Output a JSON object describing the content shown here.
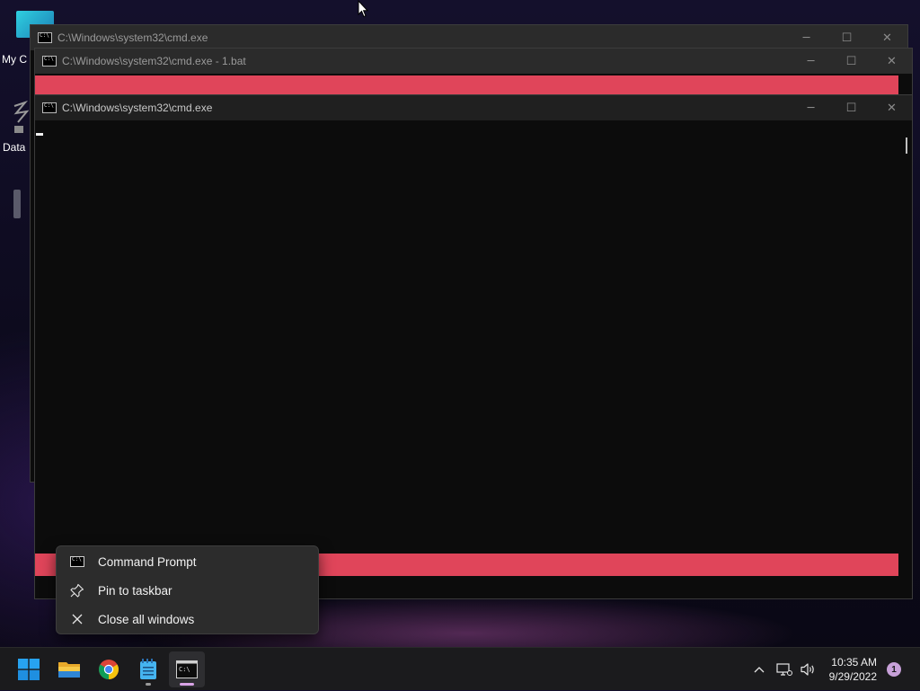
{
  "desktop": {
    "icons": [
      {
        "label": "My C"
      },
      {
        "label": "Data"
      }
    ]
  },
  "windows": [
    {
      "title": "C:\\Windows\\system32\\cmd.exe",
      "minimize": "─",
      "maximize": "☐",
      "close": "✕"
    },
    {
      "title": "C:\\Windows\\system32\\cmd.exe - 1.bat",
      "minimize": "─",
      "maximize": "☐",
      "close": "✕"
    },
    {
      "title": "C:\\Windows\\system32\\cmd.exe",
      "minimize": "─",
      "maximize": "☐",
      "close": "✕"
    }
  ],
  "context_menu": {
    "items": [
      {
        "label": "Command Prompt",
        "icon": "cmd-icon"
      },
      {
        "label": "Pin to taskbar",
        "icon": "pin-icon"
      },
      {
        "label": "Close all windows",
        "icon": "close-icon"
      }
    ]
  },
  "taskbar": {
    "apps": [
      {
        "name": "start",
        "icon": "windows-logo-icon"
      },
      {
        "name": "file-explorer",
        "icon": "folder-icon"
      },
      {
        "name": "chrome",
        "icon": "chrome-icon"
      },
      {
        "name": "notepad",
        "icon": "notepad-icon"
      },
      {
        "name": "command-prompt",
        "icon": "cmd-icon"
      }
    ],
    "tray": {
      "chevron": "^",
      "time": "10:35 AM",
      "date": "9/29/2022",
      "notification_count": "1"
    }
  },
  "colors": {
    "accent_red": "#e0455a",
    "console_bg": "#0c0c0c",
    "taskbar_bg": "#1b1b1d"
  }
}
